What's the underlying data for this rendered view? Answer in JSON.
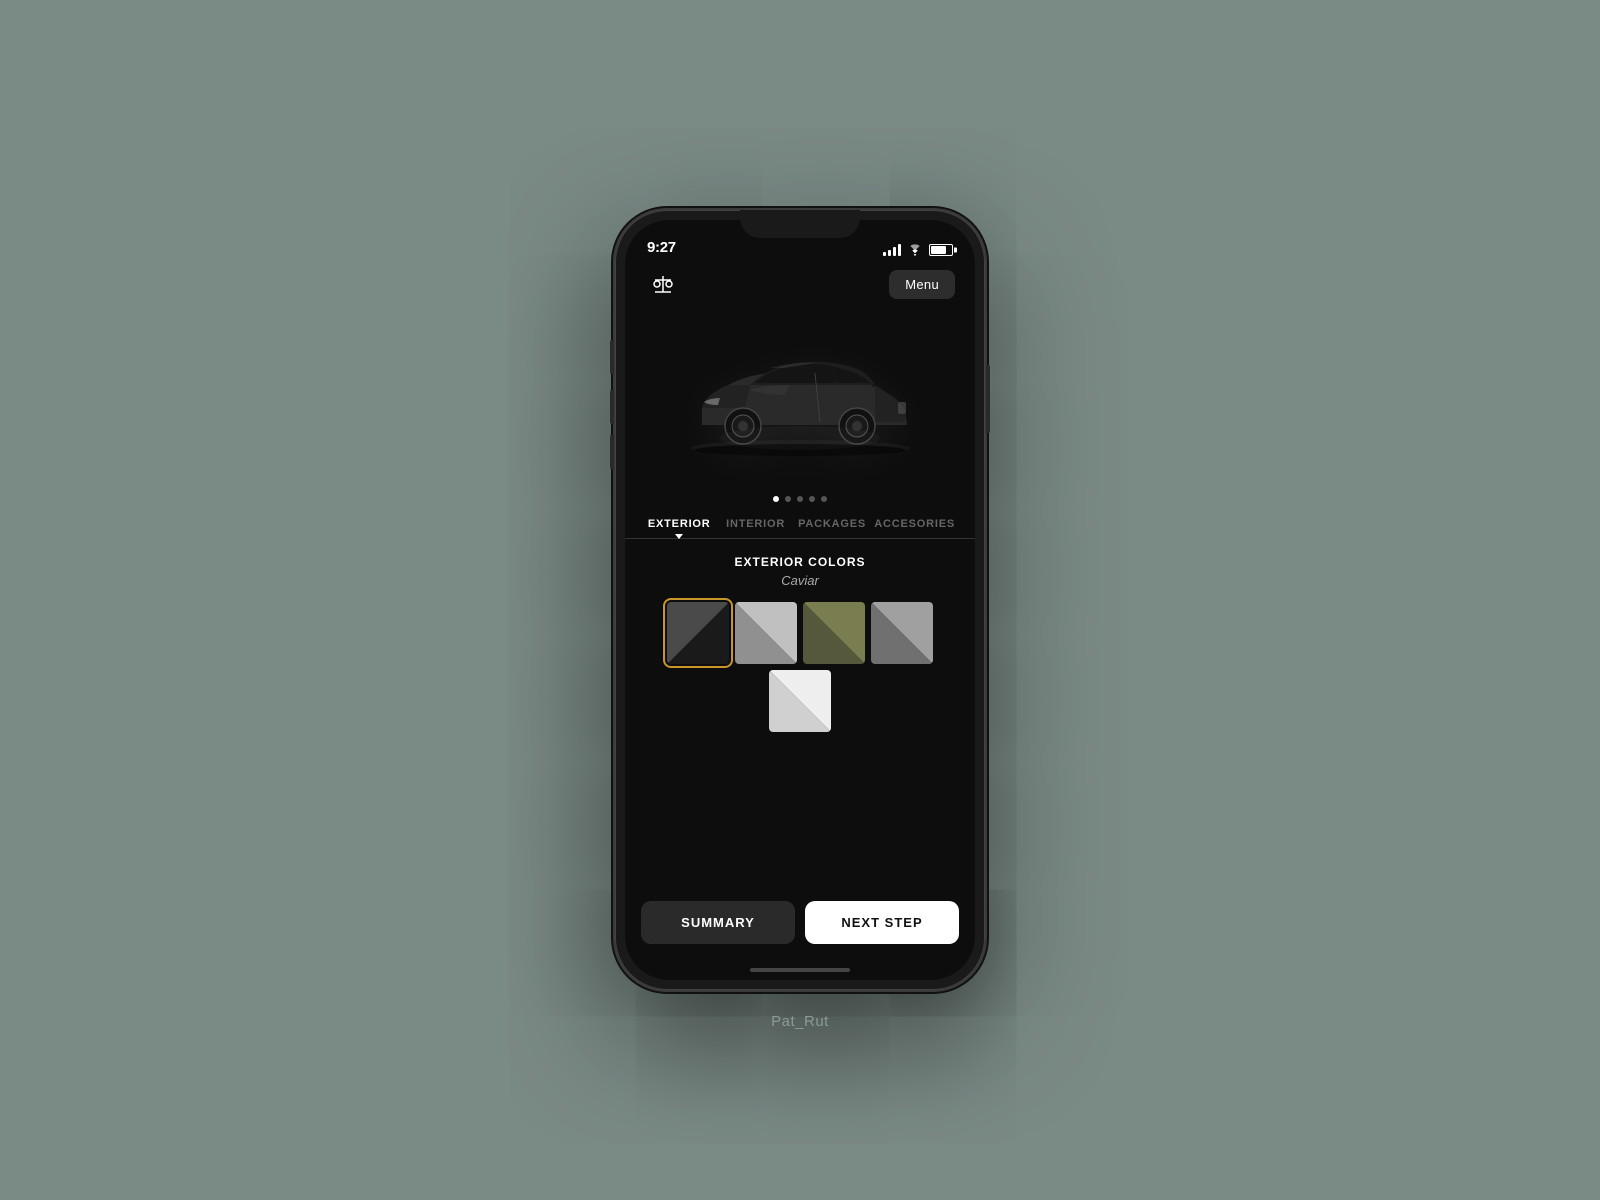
{
  "statusBar": {
    "time": "9:27"
  },
  "header": {
    "menuLabel": "Menu"
  },
  "carDisplay": {
    "dots": [
      true,
      false,
      false,
      false,
      false
    ]
  },
  "tabs": [
    {
      "label": "EXTERIOR",
      "active": true
    },
    {
      "label": "INTERIOR",
      "active": false
    },
    {
      "label": "PACKAGES",
      "active": false
    },
    {
      "label": "ACCESORIES",
      "active": false
    }
  ],
  "exteriorColors": {
    "sectionTitle": "EXTERIOR COLORS",
    "selectedColorName": "Caviar",
    "colors": [
      {
        "id": "caviar",
        "label": "Caviar",
        "topLeft": "#3a3a3a",
        "bottomRight": "#1a1a1a",
        "selected": true
      },
      {
        "id": "silver",
        "label": "Silver",
        "topLeft": "#b0b0b0",
        "bottomRight": "#888",
        "selected": false
      },
      {
        "id": "olive",
        "label": "Olive",
        "topLeft": "#6b6e4a",
        "bottomRight": "#4a4d32",
        "selected": false
      },
      {
        "id": "gray",
        "label": "Gray",
        "topLeft": "#909090",
        "bottomRight": "#6a6a6a",
        "selected": false
      },
      {
        "id": "white",
        "label": "White",
        "topLeft": "#e8e8e8",
        "bottomRight": "#c8c8c8",
        "selected": false
      }
    ]
  },
  "buttons": {
    "summary": "SUMMARY",
    "nextStep": "NEXT STEP"
  },
  "watermark": "Pat_Rut"
}
